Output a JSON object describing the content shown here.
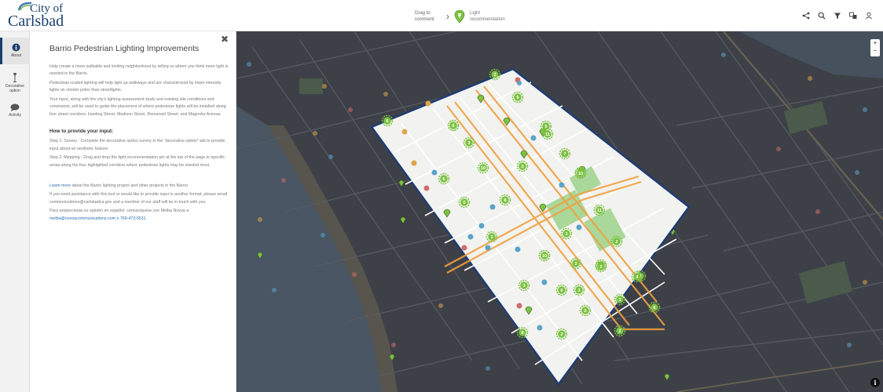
{
  "header": {
    "logo_line1": "City of",
    "logo_line2": "Carlsbad",
    "drag_text": "Drag to comment",
    "pin_text": "Light recommendation"
  },
  "toolbar": {
    "icons": [
      "share-icon",
      "search-icon",
      "filter-icon",
      "translate-icon",
      "user-icon"
    ]
  },
  "rail": {
    "items": [
      {
        "label": "About",
        "icon": "info-icon",
        "active": true
      },
      {
        "label": "Decorative option",
        "icon": "lamp-post-icon",
        "active": false
      },
      {
        "label": "Activity",
        "icon": "chat-icon",
        "active": false
      }
    ]
  },
  "panel": {
    "title": "Barrio Pedestrian Lighting Improvements",
    "p1": "Help create a more walkable and inviting neighborhood by telling us where you think more light is needed in the Barrio.",
    "p2": "Pedestrian-scaled lighting will help light up walkways and are characterized by lower intensity lights on shorter poles than streetlights.",
    "p3": "Your input, along with the city's lighting assessment study and existing site conditions and constraints, will be used to guide the placement of where pedestrian lights will be installed along four street corridors: Harding Street, Madison Street, Roosevelt Street, and Magnolia Avenue.",
    "h_provide": "How to provide your input:",
    "step1": "Step 1: Survey - Complete the decorative option survey in the \"decorative option\" tab to provide input about an aesthetic feature.",
    "step2": "Step 2: Mapping - Drag and drop the light recommendation pin at the top of the page to specific areas along the four highlighted corridors where pedestrian lights may be needed most.",
    "learn_link": "Learn more",
    "learn_rest": " about the Barrio lighting project and other projects in the Barrio.",
    "assist": "If you need assistance with this tool or would like to provide input in another format, please email communications@carlsbadca.gov and a member of our staff will be in touch with you.",
    "spanish": "Para proporcionar su opinión en español, comuníquese con Melba Novoa a",
    "spanish_contact": "melba@novoacommunications.com o 760-473-5511."
  },
  "map": {
    "zoom_in": "+",
    "zoom_out": "−",
    "info": "i",
    "numbered_markers": [
      "2",
      "9",
      "6",
      "12",
      "3",
      "11",
      "5",
      "7",
      "10",
      "2",
      "6",
      "2",
      "5",
      "8",
      "11",
      "3",
      "3",
      "2",
      "4",
      "2",
      "6",
      "3",
      "6",
      "4",
      "3",
      "2",
      "8",
      "2",
      "2",
      "6",
      "4",
      "3",
      "2",
      "10",
      "10",
      "6"
    ]
  },
  "colors": {
    "brand": "#1b3f6b",
    "marker_green": "#7cc242",
    "corridor_orange": "#f0a040",
    "map_dark": "#3d4147",
    "poly_border": "#1e3c73"
  }
}
